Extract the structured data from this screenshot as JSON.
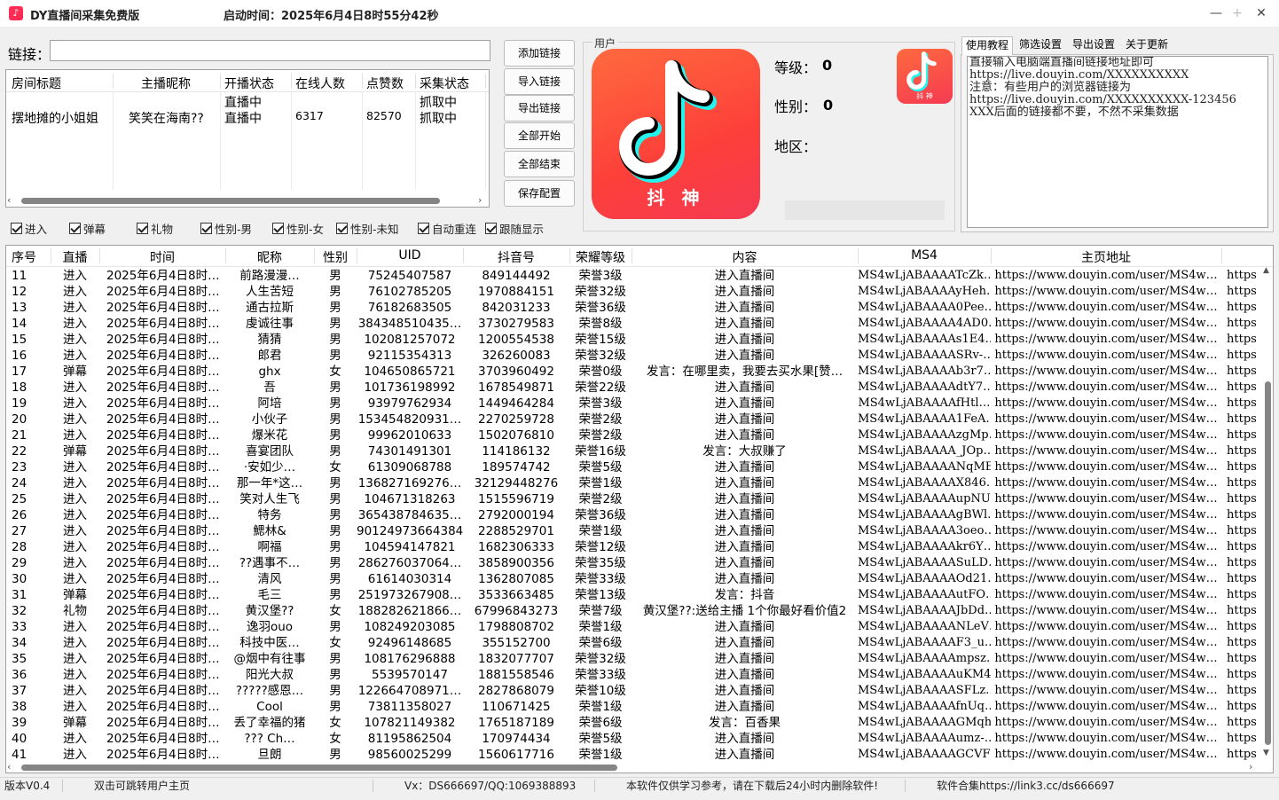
{
  "window": {
    "title": "DY直播间采集免费版",
    "start_time": "启动时间：2025年6月4日8时55分42秒",
    "min": "—",
    "max": "+",
    "close": "✕"
  },
  "link": {
    "label": "链接：",
    "value": ""
  },
  "room_list": {
    "headers": [
      "房间标题",
      "主播昵称",
      "开播状态",
      "在线人数",
      "点赞数",
      "采集状态"
    ],
    "rows": [
      [
        "",
        "",
        "直播中",
        "",
        "",
        "抓取中"
      ],
      [
        "摆地摊的小姐姐",
        "笑笑在海南??",
        "直播中",
        "6317",
        "82570",
        "抓取中"
      ]
    ]
  },
  "buttons": [
    "添加链接",
    "导入链接",
    "导出链接",
    "全部开始",
    "全部结束",
    "保存配置"
  ],
  "user": {
    "legend": "用户",
    "logo_text": "抖 神",
    "small_logo_text": "抖 神",
    "level_label": "等级：",
    "level_value": "0",
    "gender_label": "性别：",
    "gender_value": "0",
    "region_label": "地区："
  },
  "tabs": [
    "使用教程",
    "筛选设置",
    "导出设置",
    "关于更新"
  ],
  "help_text": "直接输入电脑端直播间链接地址即可\nhttps://live.douyin.com/XXXXXXXXXX\n注意：有些用户的浏览器链接为\nhttps://live.douyin.com/XXXXXXXXXX-123456\nXXX后面的链接都不要，不然不采集数据",
  "checkboxes": [
    "进入",
    "弹幕",
    "礼物",
    "性别-男",
    "性别-女",
    "性别-未知",
    "自动重连",
    "跟随显示"
  ],
  "table": {
    "headers": [
      "序号",
      "直播",
      "时间",
      "昵称",
      "性别",
      "UID",
      "抖音号",
      "荣耀等级",
      "内容",
      "MS4",
      "主页地址",
      ""
    ],
    "rows": [
      [
        "11",
        "进入",
        "2025年6月4日8时…",
        "前路漫漫…",
        "男",
        "75245407587",
        "849144492",
        "荣誉3级",
        "进入直播间",
        "MS4wLjABAAAATcZk…",
        "https://www.douyin.com/user/MS4w…",
        "https"
      ],
      [
        "12",
        "进入",
        "2025年6月4日8时…",
        "人生苦短",
        "男",
        "76102785205",
        "1970884151",
        "荣誉32级",
        "进入直播间",
        "MS4wLjABAAAAyHeh…",
        "https://www.douyin.com/user/MS4w…",
        "https"
      ],
      [
        "13",
        "进入",
        "2025年6月4日8时…",
        "通古拉斯",
        "男",
        "76182683505",
        "842031233",
        "荣誉36级",
        "进入直播间",
        "MS4wLjABAAAA0Pee…",
        "https://www.douyin.com/user/MS4w…",
        "https"
      ],
      [
        "14",
        "进入",
        "2025年6月4日8时…",
        "虔诚往事",
        "男",
        "384348510435…",
        "3730279583",
        "荣誉8级",
        "进入直播间",
        "MS4wLjABAAAA4AD0…",
        "https://www.douyin.com/user/MS4w…",
        "https"
      ],
      [
        "15",
        "进入",
        "2025年6月4日8时…",
        "猜猜",
        "男",
        "102081257072",
        "1200554538",
        "荣誉15级",
        "进入直播间",
        "MS4wLjABAAAAs1E4…",
        "https://www.douyin.com/user/MS4w…",
        "https"
      ],
      [
        "16",
        "进入",
        "2025年6月4日8时…",
        "郎君",
        "男",
        "92115354313",
        "326260083",
        "荣誉32级",
        "进入直播间",
        "MS4wLjABAAAASRv-…",
        "https://www.douyin.com/user/MS4w…",
        "https"
      ],
      [
        "17",
        "弹幕",
        "2025年6月4日8时…",
        "ghx",
        "女",
        "104650865721",
        "3703960492",
        "荣誉0级",
        "发言：在哪里卖，我要去买水果[赞…",
        "MS4wLjABAAAAb3r7…",
        "https://www.douyin.com/user/MS4w…",
        "https"
      ],
      [
        "18",
        "进入",
        "2025年6月4日8时…",
        "吾",
        "男",
        "101736198992",
        "1678549871",
        "荣誉22级",
        "进入直播间",
        "MS4wLjABAAAAdtY7…",
        "https://www.douyin.com/user/MS4w…",
        "https"
      ],
      [
        "19",
        "进入",
        "2025年6月4日8时…",
        "阿培",
        "男",
        "93979762934",
        "1449464284",
        "荣誉3级",
        "进入直播间",
        "MS4wLjABAAAAfHtl…",
        "https://www.douyin.com/user/MS4w…",
        "https"
      ],
      [
        "20",
        "进入",
        "2025年6月4日8时…",
        "小伙子",
        "男",
        "153454820931…",
        "2270259728",
        "荣誉2级",
        "进入直播间",
        "MS4wLjABAAAA1FeA…",
        "https://www.douyin.com/user/MS4w…",
        "https"
      ],
      [
        "21",
        "进入",
        "2025年6月4日8时…",
        "爆米花",
        "男",
        "99962010633",
        "1502076810",
        "荣誉2级",
        "进入直播间",
        "MS4wLjABAAAAzgMp…",
        "https://www.douyin.com/user/MS4w…",
        "https"
      ],
      [
        "22",
        "弹幕",
        "2025年6月4日8时…",
        "喜宴团队",
        "男",
        "74301491301",
        "114186132",
        "荣誉16级",
        "发言：大叔赚了",
        "MS4wLjABAAAA_JOp…",
        "https://www.douyin.com/user/MS4w…",
        "https"
      ],
      [
        "23",
        "进入",
        "2025年6月4日8时…",
        "·安如少…",
        "女",
        "61309068788",
        "189574742",
        "荣誉5级",
        "进入直播间",
        "MS4wLjABAAAANqME…",
        "https://www.douyin.com/user/MS4w…",
        "https"
      ],
      [
        "24",
        "进入",
        "2025年6月4日8时…",
        "那一年*这…",
        "男",
        "136827169276…",
        "32129448276",
        "荣誉1级",
        "进入直播间",
        "MS4wLjABAAAAX846…",
        "https://www.douyin.com/user/MS4w…",
        "https"
      ],
      [
        "25",
        "进入",
        "2025年6月4日8时…",
        "笑对人生飞",
        "男",
        "104671318263",
        "1515596719",
        "荣誉2级",
        "进入直播间",
        "MS4wLjABAAAAupNU…",
        "https://www.douyin.com/user/MS4w…",
        "https"
      ],
      [
        "26",
        "进入",
        "2025年6月4日8时…",
        "特务",
        "男",
        "365438784635…",
        "2792000194",
        "荣誉36级",
        "进入直播间",
        "MS4wLjABAAAAgBWl…",
        "https://www.douyin.com/user/MS4w…",
        "https"
      ],
      [
        "27",
        "进入",
        "2025年6月4日8时…",
        "鰓林&",
        "男",
        "901249736643847",
        "2288529701",
        "荣誉1级",
        "进入直播间",
        "MS4wLjABAAAA3oeo…",
        "https://www.douyin.com/user/MS4w…",
        "https"
      ],
      [
        "28",
        "进入",
        "2025年6月4日8时…",
        "啊福",
        "男",
        "104594147821",
        "1682306333",
        "荣誉12级",
        "进入直播间",
        "MS4wLjABAAAAkr6Y…",
        "https://www.douyin.com/user/MS4w…",
        "https"
      ],
      [
        "29",
        "进入",
        "2025年6月4日8时…",
        "??遇事不…",
        "男",
        "286276037064…",
        "3858900356",
        "荣誉35级",
        "进入直播间",
        "MS4wLjABAAAASuLD…",
        "https://www.douyin.com/user/MS4w…",
        "https"
      ],
      [
        "30",
        "进入",
        "2025年6月4日8时…",
        "清风",
        "男",
        "61614030314",
        "1362807085",
        "荣誉33级",
        "进入直播间",
        "MS4wLjABAAAAOd21…",
        "https://www.douyin.com/user/MS4w…",
        "https"
      ],
      [
        "31",
        "弹幕",
        "2025年6月4日8时…",
        "毛三",
        "男",
        "251973267908…",
        "3533663485",
        "荣誉13级",
        "发言：抖音",
        "MS4wLjABAAAAutFO…",
        "https://www.douyin.com/user/MS4w…",
        "https"
      ],
      [
        "32",
        "礼物",
        "2025年6月4日8时…",
        "黄汉堡??",
        "女",
        "188282621866…",
        "67996843273",
        "荣誉7级",
        "黄汉堡??:送给主播 1个你最好看价值2",
        "MS4wLjABAAAAJbDd…",
        "https://www.douyin.com/user/MS4w…",
        "https"
      ],
      [
        "33",
        "进入",
        "2025年6月4日8时…",
        "逸羽ouo",
        "男",
        "108249203085",
        "1798808702",
        "荣誉1级",
        "进入直播间",
        "MS4wLjABAAAANLeV…",
        "https://www.douyin.com/user/MS4w…",
        "https"
      ],
      [
        "34",
        "进入",
        "2025年6月4日8时…",
        "科技中医…",
        "女",
        "92496148685",
        "355152700",
        "荣誉6级",
        "进入直播间",
        "MS4wLjABAAAAF3_u…",
        "https://www.douyin.com/user/MS4w…",
        "https"
      ],
      [
        "35",
        "进入",
        "2025年6月4日8时…",
        "@烟中有往事",
        "男",
        "108176296888",
        "1832077707",
        "荣誉32级",
        "进入直播间",
        "MS4wLjABAAAAmpsz…",
        "https://www.douyin.com/user/MS4w…",
        "https"
      ],
      [
        "36",
        "进入",
        "2025年6月4日8时…",
        "阳光大叔",
        "男",
        "5539570147",
        "1881558546",
        "荣誉33级",
        "进入直播间",
        "MS4wLjABAAAAuKM4…",
        "https://www.douyin.com/user/MS4w…",
        "https"
      ],
      [
        "37",
        "进入",
        "2025年6月4日8时…",
        "?????感恩…",
        "男",
        "122664708971…",
        "2827868079",
        "荣誉10级",
        "进入直播间",
        "MS4wLjABAAAASFLz…",
        "https://www.douyin.com/user/MS4w…",
        "https"
      ],
      [
        "38",
        "进入",
        "2025年6月4日8时…",
        "Cool",
        "男",
        "73811358027",
        "110671425",
        "荣誉1级",
        "进入直播间",
        "MS4wLjABAAAAfnUq…",
        "https://www.douyin.com/user/MS4w…",
        "https"
      ],
      [
        "39",
        "弹幕",
        "2025年6月4日8时…",
        "丢了幸福的猪",
        "女",
        "107821149382",
        "1765187189",
        "荣誉6级",
        "发言：百香果",
        "MS4wLjABAAAAGMqh…",
        "https://www.douyin.com/user/MS4w…",
        "https"
      ],
      [
        "40",
        "进入",
        "2025年6月4日8时…",
        "???   Ch…",
        "女",
        "81195862504",
        "170974434",
        "荣誉5级",
        "进入直播间",
        "MS4wLjABAAAAumz-…",
        "https://www.douyin.com/user/MS4w…",
        "https"
      ],
      [
        "41",
        "进入",
        "2025年6月4日8时…",
        "旦朗",
        "男",
        "98560025299",
        "1560617716",
        "荣誉1级",
        "进入直播间",
        "MS4wLjABAAAAGCVF…",
        "https://www.douyin.com/user/MS4w…",
        "https"
      ]
    ]
  },
  "status": {
    "version": "版本V0.4",
    "hint": "双击可跳转用户主页",
    "contact": "Vx：DS666697/QQ:1069388893",
    "notice": "本软件仅供学习参考，请在下载后24小时内删除软件!",
    "collection": "软件合集https://link3.cc/ds666697"
  },
  "colors": {
    "brand": "#fe2c55",
    "logo_bg": "#fd4a3a"
  }
}
